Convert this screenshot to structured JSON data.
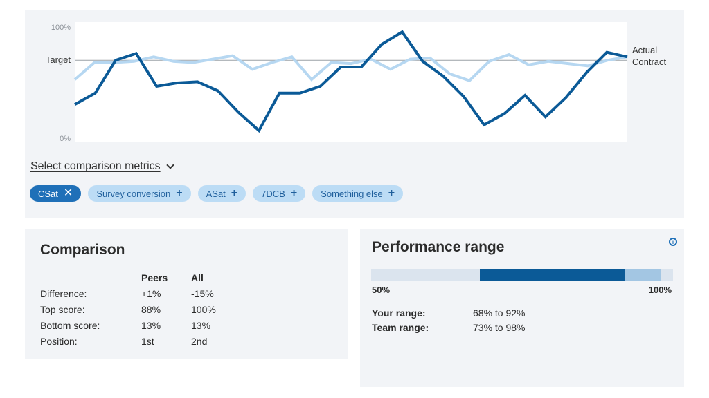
{
  "chart": {
    "y_top_label": "100%",
    "y_bottom_label": "0%",
    "target_label": "Target",
    "target_value": 70
  },
  "chart_data": {
    "type": "line",
    "ylim": [
      0,
      100
    ],
    "x": [
      1,
      2,
      3,
      4,
      5,
      6,
      7,
      8,
      9,
      10,
      11,
      12,
      13,
      14,
      15,
      16,
      17,
      18,
      19,
      20,
      21,
      22,
      23,
      24,
      25,
      26,
      27,
      28,
      29
    ],
    "series": [
      {
        "name": "Actual",
        "color": "#0b5a97",
        "values": [
          31,
          41,
          70,
          76,
          47,
          50,
          51,
          43,
          24,
          8,
          41,
          41,
          47,
          64,
          64,
          84,
          95,
          69,
          56,
          38,
          13,
          23,
          39,
          20,
          37,
          59,
          77,
          73
        ]
      },
      {
        "name": "Contract",
        "color": "#b6d7f1",
        "values": [
          53,
          68,
          68,
          69,
          73,
          69,
          68,
          71,
          74,
          62,
          68,
          73,
          53,
          68,
          67,
          71,
          62,
          71,
          72,
          58,
          52,
          69,
          75,
          66,
          69,
          67,
          65,
          70,
          73
        ]
      }
    ]
  },
  "metrics": {
    "select_label": "Select comparison metrics",
    "chips": [
      {
        "label": "CSat",
        "active": true,
        "symbol": "✕"
      },
      {
        "label": "Survey conversion",
        "active": false,
        "symbol": "+"
      },
      {
        "label": "ASat",
        "active": false,
        "symbol": "+"
      },
      {
        "label": "7DCB",
        "active": false,
        "symbol": "+"
      },
      {
        "label": "Something else",
        "active": false,
        "symbol": "+"
      }
    ]
  },
  "comparison": {
    "title": "Comparison",
    "headers": [
      "",
      "Peers",
      "All"
    ],
    "rows": [
      [
        "Difference:",
        "+1%",
        "-15%"
      ],
      [
        "Top score:",
        "88%",
        "100%"
      ],
      [
        "Bottom score:",
        "13%",
        "13%"
      ],
      [
        "Position:",
        "1st",
        "2nd"
      ]
    ]
  },
  "performance": {
    "title": "Performance range",
    "info_icon": "info-icon",
    "min_label": "50%",
    "max_label": "100%",
    "team_range": [
      73,
      98
    ],
    "your_range": [
      68,
      92
    ],
    "rows": [
      {
        "label": "Your range:",
        "value": "68% to 92%"
      },
      {
        "label": "Team range:",
        "value": "73% to 98%"
      }
    ]
  },
  "colors": {
    "accent": "#1f70b8",
    "dark_blue": "#0b5a97",
    "light_blue": "#b6d7f1",
    "chip_bg": "#bcdcf5",
    "panel_bg": "#f2f4f7"
  }
}
